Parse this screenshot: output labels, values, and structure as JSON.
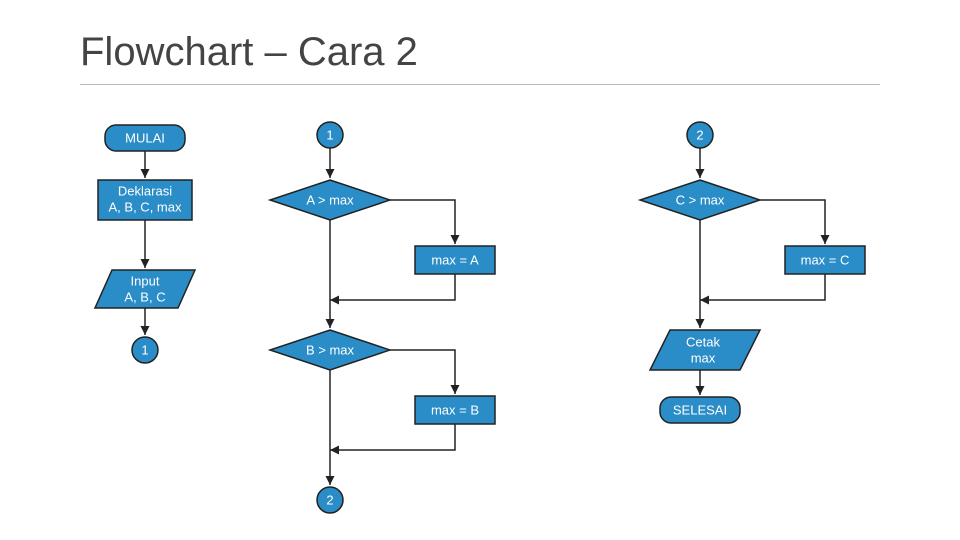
{
  "title": "Flowchart – Cara 2",
  "nodes": {
    "start": "MULAI",
    "declare1": "Deklarasi",
    "declare2": "A, B, C, max",
    "input1": "Input",
    "input2": "A, B, C",
    "conn1a": "1",
    "conn1b": "1",
    "conn2a": "2",
    "conn2b": "2",
    "decA": "A > max",
    "setA": "max = A",
    "decB": "B > max",
    "setB": "max = B",
    "decC": "C > max",
    "setC": "max = C",
    "print1": "Cetak",
    "print2": "max",
    "end": "SELESAI"
  }
}
